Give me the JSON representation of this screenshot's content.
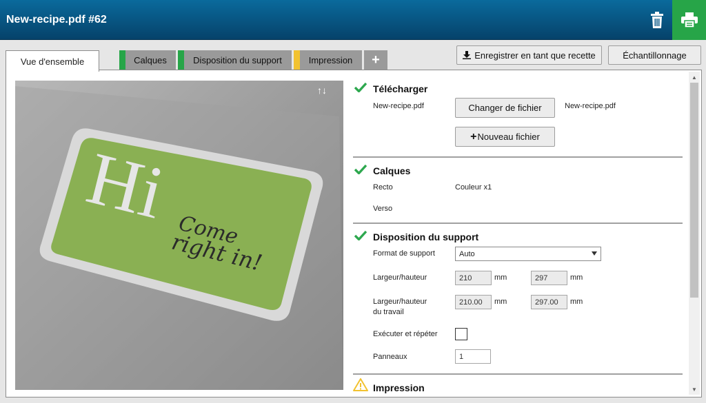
{
  "header": {
    "title": "New-recipe.pdf #62",
    "trash_icon": "trash-icon",
    "print_icon": "printer-icon",
    "print_color": "#27a548",
    "bar_color": "#06426a"
  },
  "tabs": [
    {
      "label": "Vue d'ensemble",
      "status_color": null
    },
    {
      "label": "Calques",
      "status_color": "#27a548"
    },
    {
      "label": "Disposition du support",
      "status_color": "#27a548"
    },
    {
      "label": "Impression",
      "status_color": "#f2c230"
    }
  ],
  "tab_add_label": "+",
  "toolbar": {
    "save_recipe_label": "Enregistrer en tant que recette",
    "sampling_label": "Échantillonnage"
  },
  "preview": {
    "logo_big_text": "Hi",
    "logo_line1": "Come",
    "logo_line2": "right in!",
    "updown_label": "↑↓",
    "sign_color": "#8ab053"
  },
  "sections": {
    "upload": {
      "title": "Télécharger",
      "file_label": "New-recipe.pdf",
      "change_file_label": "Changer de fichier",
      "current_file": "New-recipe.pdf",
      "new_file_label": "Nouveau fichier",
      "status": "ok"
    },
    "layers": {
      "title": "Calques",
      "front_label": "Recto",
      "front_value": "Couleur x1",
      "back_label": "Verso",
      "status": "ok"
    },
    "media": {
      "title": "Disposition du support",
      "format_label": "Format de support",
      "format_value": "Auto",
      "size_label": "Largeur/hauteur",
      "width": "210",
      "height": "297",
      "unit": "mm",
      "work_size_label_1": "Largeur/hauteur",
      "work_size_label_2": "du travail",
      "work_width": "210.00",
      "work_height": "297.00",
      "step_repeat_label": "Exécuter et répéter",
      "panels_label": "Panneaux",
      "panels_value": "1",
      "status": "ok"
    },
    "print": {
      "title": "Impression",
      "status": "warning"
    }
  },
  "status_colors": {
    "ok": "#2ea84f",
    "warning": "#f2c230"
  }
}
